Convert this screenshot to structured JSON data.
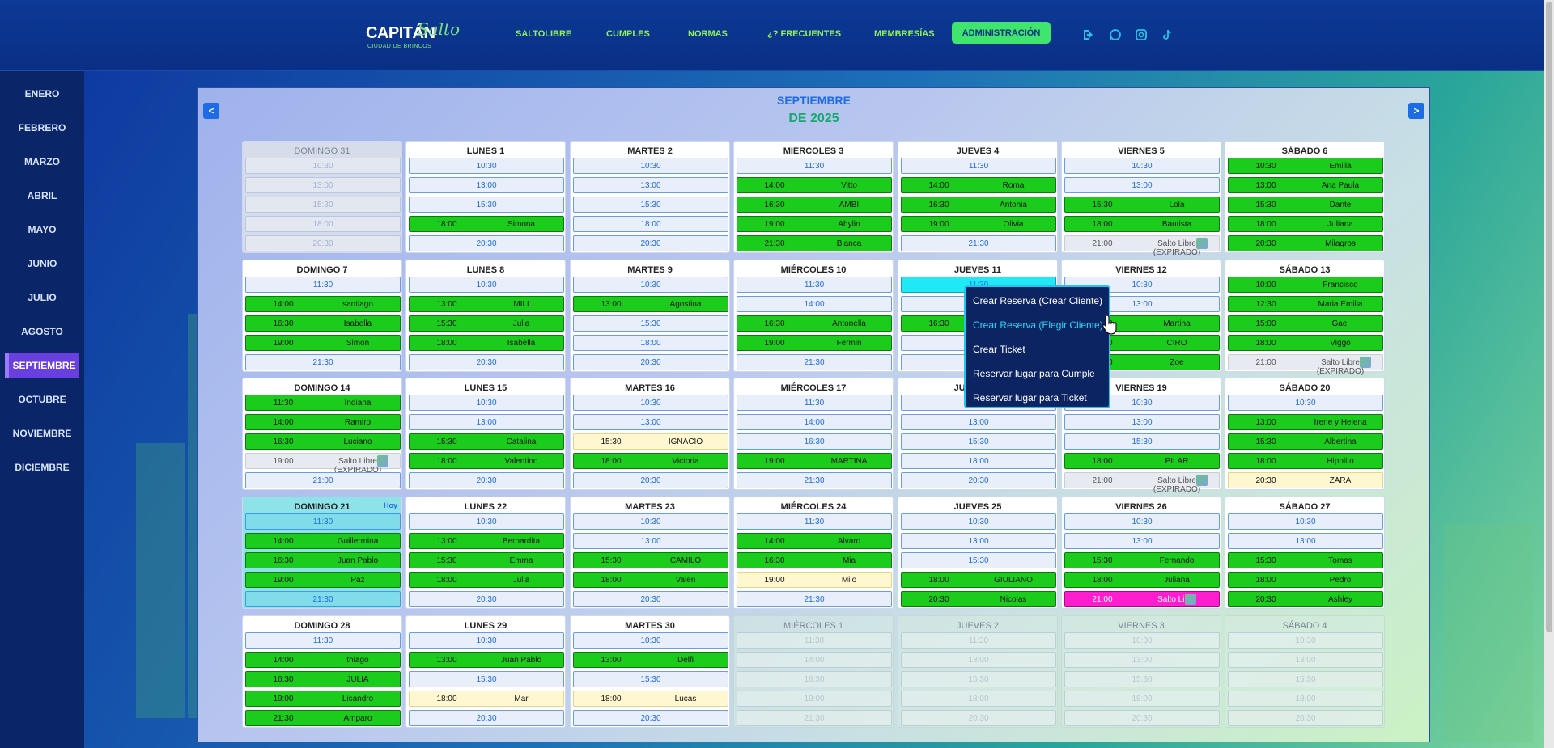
{
  "brand": {
    "name": "CAPITÁN",
    "script": "Salto",
    "tagline": "CIUDAD DE BRINCOS"
  },
  "nav": [
    "SALTOLIBRE",
    "CUMPLES",
    "NORMAS",
    "¿? FRECUENTES",
    "MEMBRESÍAS"
  ],
  "admin_label": "ADMINISTRACIÓN",
  "header_icons": [
    "logout-icon",
    "whatsapp-icon",
    "instagram-icon",
    "tiktok-icon"
  ],
  "months": [
    "ENERO",
    "FEBRERO",
    "MARZO",
    "ABRIL",
    "MAYO",
    "JUNIO",
    "JULIO",
    "AGOSTO",
    "SEPTIEMBRE",
    "OCTUBRE",
    "NOVIEMBRE",
    "DICIEMBRE"
  ],
  "active_month": "SEPTIEMBRE",
  "calendar": {
    "title_month": "SEPTIEMBRE",
    "title_year": "DE  2025",
    "prev": "<",
    "next": ">",
    "today_label": "Hoy",
    "weeks": [
      [
        {
          "name": "DOMINGO 31",
          "state": "muted",
          "slots": [
            {
              "time": "10:30"
            },
            {
              "time": "13:00"
            },
            {
              "time": "15:30"
            },
            {
              "time": "18:00"
            },
            {
              "time": "20:30"
            }
          ]
        },
        {
          "name": "LUNES 1",
          "slots": [
            {
              "time": "10:30"
            },
            {
              "time": "13:00"
            },
            {
              "time": "15:30"
            },
            {
              "time": "18:00",
              "name": "Simona",
              "type": "booked"
            },
            {
              "time": "20:30"
            }
          ]
        },
        {
          "name": "MARTES 2",
          "slots": [
            {
              "time": "10:30"
            },
            {
              "time": "13:00"
            },
            {
              "time": "15:30"
            },
            {
              "time": "18:00"
            },
            {
              "time": "20:30"
            }
          ]
        },
        {
          "name": "MIÉRCOLES 3",
          "slots": [
            {
              "time": "11:30"
            },
            {
              "time": "14:00",
              "name": "Vitto",
              "type": "booked"
            },
            {
              "time": "16:30",
              "name": "AMBI",
              "type": "booked"
            },
            {
              "time": "19:00",
              "name": "Ahylin",
              "type": "booked"
            },
            {
              "time": "21:30",
              "name": "Bianca",
              "type": "booked"
            }
          ]
        },
        {
          "name": "JUEVES 4",
          "slots": [
            {
              "time": "11:30"
            },
            {
              "time": "14:00",
              "name": "Roma",
              "type": "booked"
            },
            {
              "time": "16:30",
              "name": "Antonia",
              "type": "booked"
            },
            {
              "time": "19:00",
              "name": "Olivia",
              "type": "booked"
            },
            {
              "time": "21:30"
            }
          ]
        },
        {
          "name": "VIERNES 5",
          "slots": [
            {
              "time": "10:30"
            },
            {
              "time": "13:00"
            },
            {
              "time": "15:30",
              "name": "Lola",
              "type": "booked"
            },
            {
              "time": "18:00",
              "name": "Bautista",
              "type": "booked"
            },
            {
              "time": "21:00",
              "name": "Salto Libre (EXPIRADO)",
              "type": "expired",
              "ticket": true
            }
          ]
        },
        {
          "name": "SÁBADO 6",
          "slots": [
            {
              "time": "10:30",
              "name": "Emilia",
              "type": "booked"
            },
            {
              "time": "13:00",
              "name": "Ana Paula",
              "type": "booked"
            },
            {
              "time": "15:30",
              "name": "Dante",
              "type": "booked"
            },
            {
              "time": "18:00",
              "name": "Juliana",
              "type": "booked"
            },
            {
              "time": "20:30",
              "name": "Milagros",
              "type": "booked"
            }
          ]
        }
      ],
      [
        {
          "name": "DOMINGO 7",
          "slots": [
            {
              "time": "11:30"
            },
            {
              "time": "14:00",
              "name": "santiago",
              "type": "booked"
            },
            {
              "time": "16:30",
              "name": "Isabella",
              "type": "booked"
            },
            {
              "time": "19:00",
              "name": "Simon",
              "type": "booked"
            },
            {
              "time": "21:30"
            }
          ]
        },
        {
          "name": "LUNES 8",
          "slots": [
            {
              "time": "10:30"
            },
            {
              "time": "13:00",
              "name": "MILI",
              "type": "booked"
            },
            {
              "time": "15:30",
              "name": "Julia",
              "type": "booked"
            },
            {
              "time": "18:00",
              "name": "Isabella",
              "type": "booked"
            },
            {
              "time": "20:30"
            }
          ]
        },
        {
          "name": "MARTES 9",
          "slots": [
            {
              "time": "10:30"
            },
            {
              "time": "13:00",
              "name": "Agostina",
              "type": "booked"
            },
            {
              "time": "15:30"
            },
            {
              "time": "18:00"
            },
            {
              "time": "20:30"
            }
          ]
        },
        {
          "name": "MIÉRCOLES 10",
          "slots": [
            {
              "time": "11:30"
            },
            {
              "time": "14:00"
            },
            {
              "time": "16:30",
              "name": "Antonella",
              "type": "booked"
            },
            {
              "time": "19:00",
              "name": "Fermin",
              "type": "booked"
            },
            {
              "time": "21:30"
            }
          ]
        },
        {
          "name": "JUEVES 11",
          "slots": [
            {
              "time": "11:30",
              "type": "cyan"
            },
            {
              "time": ""
            },
            {
              "time": "16:30",
              "type": "booked"
            },
            {
              "time": ""
            },
            {
              "time": ""
            }
          ]
        },
        {
          "name": "VIERNES 12",
          "slots": [
            {
              "time": "10:30"
            },
            {
              "time": "13:00"
            },
            {
              "time": "15:30",
              "name": "Martina",
              "type": "booked"
            },
            {
              "time": "18:00",
              "name": "CIRO",
              "type": "booked"
            },
            {
              "time": "20:30",
              "name": "Zoe",
              "type": "booked"
            }
          ]
        },
        {
          "name": "SÁBADO 13",
          "slots": [
            {
              "time": "10:00",
              "name": "Francisco",
              "type": "booked"
            },
            {
              "time": "12:30",
              "name": "Maria Emilia",
              "type": "booked"
            },
            {
              "time": "15:00",
              "name": "Gael",
              "type": "booked"
            },
            {
              "time": "18:00",
              "name": "Viggo",
              "type": "booked"
            },
            {
              "time": "21:00",
              "name": "Salto Libre (EXPIRADO)",
              "type": "expired",
              "ticket": true
            }
          ]
        }
      ],
      [
        {
          "name": "DOMINGO 14",
          "slots": [
            {
              "time": "11:30",
              "name": "Indiana",
              "type": "booked"
            },
            {
              "time": "14:00",
              "name": "Ramiro",
              "type": "booked"
            },
            {
              "time": "16:30",
              "name": "Luciano",
              "type": "booked"
            },
            {
              "time": "19:00",
              "name": "Salto Libre (EXPIRADO)",
              "type": "expired",
              "ticket": true
            },
            {
              "time": "21:00"
            }
          ]
        },
        {
          "name": "LUNES 15",
          "slots": [
            {
              "time": "10:30"
            },
            {
              "time": "13:00"
            },
            {
              "time": "15:30",
              "name": "Catalina",
              "type": "booked"
            },
            {
              "time": "18:00",
              "name": "Valentino",
              "type": "booked"
            },
            {
              "time": "20:30"
            }
          ]
        },
        {
          "name": "MARTES 16",
          "slots": [
            {
              "time": "10:30"
            },
            {
              "time": "13:00"
            },
            {
              "time": "15:30",
              "name": "IGNACIO",
              "type": "pending"
            },
            {
              "time": "18:00",
              "name": "Victoria",
              "type": "booked"
            },
            {
              "time": "20:30"
            }
          ]
        },
        {
          "name": "MIÉRCOLES 17",
          "slots": [
            {
              "time": "11:30"
            },
            {
              "time": "14:00"
            },
            {
              "time": "16:30"
            },
            {
              "time": "19:00",
              "name": "MARTINA",
              "type": "booked"
            },
            {
              "time": "21:30"
            }
          ]
        },
        {
          "name": "JUEVES 18",
          "slots": [
            {
              "time": "10:30"
            },
            {
              "time": "13:00"
            },
            {
              "time": "15:30"
            },
            {
              "time": "18:00"
            },
            {
              "time": "20:30"
            }
          ]
        },
        {
          "name": "VIERNES 19",
          "slots": [
            {
              "time": "10:30"
            },
            {
              "time": "13:00"
            },
            {
              "time": "15:30"
            },
            {
              "time": "18:00",
              "name": "PILAR",
              "type": "booked"
            },
            {
              "time": "21:00",
              "name": "Salto Libre (EXPIRADO)",
              "type": "expired",
              "ticket": true
            }
          ]
        },
        {
          "name": "SÁBADO 20",
          "slots": [
            {
              "time": "10:30"
            },
            {
              "time": "13:00",
              "name": "Irene y Helena",
              "type": "booked"
            },
            {
              "time": "15:30",
              "name": "Albertina",
              "type": "booked"
            },
            {
              "time": "18:00",
              "name": "Hipolito",
              "type": "booked"
            },
            {
              "time": "20:30",
              "name": "ZARA",
              "type": "pending"
            }
          ]
        }
      ],
      [
        {
          "name": "DOMINGO 21",
          "state": "today",
          "slots": [
            {
              "time": "11:30",
              "type": "today-slot"
            },
            {
              "time": "14:00",
              "name": "Guillermina",
              "type": "booked"
            },
            {
              "time": "16:30",
              "name": "Juan Pablo",
              "type": "booked"
            },
            {
              "time": "19:00",
              "name": "Paz",
              "type": "booked"
            },
            {
              "time": "21:30",
              "type": "today-slot"
            }
          ]
        },
        {
          "name": "LUNES 22",
          "slots": [
            {
              "time": "10:30"
            },
            {
              "time": "13:00",
              "name": "Bernardita",
              "type": "booked"
            },
            {
              "time": "15:30",
              "name": "Emma",
              "type": "booked"
            },
            {
              "time": "18:00",
              "name": "Julia",
              "type": "booked"
            },
            {
              "time": "20:30"
            }
          ]
        },
        {
          "name": "MARTES 23",
          "slots": [
            {
              "time": "10:30"
            },
            {
              "time": "13:00"
            },
            {
              "time": "15:30",
              "name": "CAMILO",
              "type": "booked"
            },
            {
              "time": "18:00",
              "name": "Valen",
              "type": "booked"
            },
            {
              "time": "20:30"
            }
          ]
        },
        {
          "name": "MIÉRCOLES 24",
          "slots": [
            {
              "time": "11:30"
            },
            {
              "time": "14:00",
              "name": "Alvaro",
              "type": "booked"
            },
            {
              "time": "16:30",
              "name": "Mia",
              "type": "booked"
            },
            {
              "time": "19:00",
              "name": "Milo",
              "type": "pending"
            },
            {
              "time": "21:30"
            }
          ]
        },
        {
          "name": "JUEVES 25",
          "slots": [
            {
              "time": "10:30"
            },
            {
              "time": "13:00"
            },
            {
              "time": "15:30"
            },
            {
              "time": "18:00",
              "name": "GIULIANO",
              "type": "booked"
            },
            {
              "time": "20:30",
              "name": "Nicolas",
              "type": "booked"
            }
          ]
        },
        {
          "name": "VIERNES 26",
          "slots": [
            {
              "time": "10:30"
            },
            {
              "time": "13:00"
            },
            {
              "time": "15:30",
              "name": "Fernando",
              "type": "booked"
            },
            {
              "time": "18:00",
              "name": "Juliana",
              "type": "booked"
            },
            {
              "time": "21:00",
              "name": "Salto Libre",
              "type": "magenta",
              "ticket": true
            }
          ]
        },
        {
          "name": "SÁBADO 27",
          "slots": [
            {
              "time": "10:30"
            },
            {
              "time": "13:00"
            },
            {
              "time": "15:30",
              "name": "Tomas",
              "type": "booked"
            },
            {
              "time": "18:00",
              "name": "Pedro",
              "type": "booked"
            },
            {
              "time": "20:30",
              "name": "Ashley",
              "type": "booked"
            }
          ]
        }
      ],
      [
        {
          "name": "DOMINGO 28",
          "slots": [
            {
              "time": "11:30"
            },
            {
              "time": "14:00",
              "name": "thiago",
              "type": "booked"
            },
            {
              "time": "16:30",
              "name": "JULIA",
              "type": "booked"
            },
            {
              "time": "19:00",
              "name": "Lisandro",
              "type": "booked"
            },
            {
              "time": "21:30",
              "name": "Amparo",
              "type": "booked"
            }
          ]
        },
        {
          "name": "LUNES 29",
          "slots": [
            {
              "time": "10:30"
            },
            {
              "time": "13:00",
              "name": "Juan Pablo",
              "type": "booked"
            },
            {
              "time": "15:30"
            },
            {
              "time": "18:00",
              "name": "Mar",
              "type": "pending"
            },
            {
              "time": "20:30"
            }
          ]
        },
        {
          "name": "MARTES 30",
          "slots": [
            {
              "time": "10:30"
            },
            {
              "time": "13:00",
              "name": "Delfi",
              "type": "booked"
            },
            {
              "time": "15:30"
            },
            {
              "time": "18:00",
              "name": "Lucas",
              "type": "pending"
            },
            {
              "time": "20:30"
            }
          ]
        },
        {
          "name": "MIÉRCOLES 1",
          "state": "faded",
          "slots": [
            {
              "time": "11:30"
            },
            {
              "time": "14:00"
            },
            {
              "time": "16:30"
            },
            {
              "time": "19:00"
            },
            {
              "time": "21:30"
            }
          ]
        },
        {
          "name": "JUEVES 2",
          "state": "faded",
          "slots": [
            {
              "time": "11:30"
            },
            {
              "time": "13:00"
            },
            {
              "time": "15:30"
            },
            {
              "time": "18:00"
            },
            {
              "time": "20:30"
            }
          ]
        },
        {
          "name": "VIERNES 3",
          "state": "faded",
          "slots": [
            {
              "time": "10:30"
            },
            {
              "time": "13:00"
            },
            {
              "time": "15:30"
            },
            {
              "time": "18:00"
            },
            {
              "time": "20:30"
            }
          ]
        },
        {
          "name": "SÁBADO 4",
          "state": "faded",
          "slots": [
            {
              "time": "10:30"
            },
            {
              "time": "13:00"
            },
            {
              "time": "15:30"
            },
            {
              "time": "18:00"
            },
            {
              "time": "20:30"
            }
          ]
        }
      ]
    ]
  },
  "context_menu": {
    "items": [
      "Crear Reserva (Crear Cliente)",
      "Crear Reserva (Elegir Cliente)",
      "Crear Ticket",
      "Reservar lugar para Cumple",
      "Reservar lugar para Ticket"
    ],
    "highlighted": 1
  },
  "colors": {
    "booked": "#1ccc1c",
    "pending": "#fff7cf",
    "magenta": "#ff1ecf",
    "accent": "#1e6be6",
    "nav_green": "#8ff05e"
  }
}
